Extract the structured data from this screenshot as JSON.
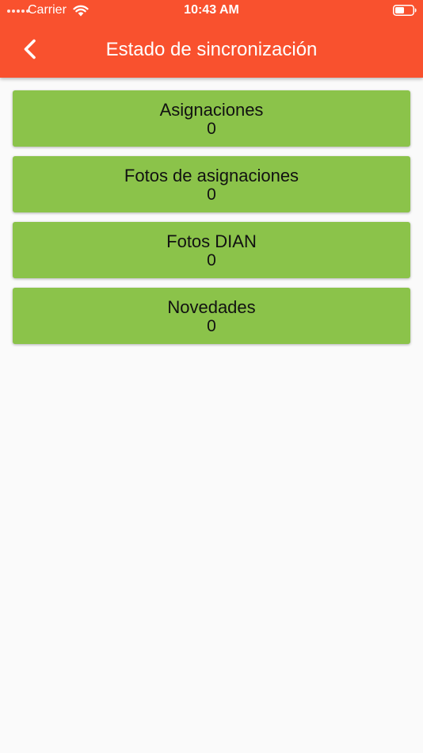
{
  "status_bar": {
    "carrier": "Carrier",
    "time": "10:43 AM"
  },
  "header": {
    "title": "Estado de sincronización",
    "back_icon": "chevron-left-icon"
  },
  "sync_items": [
    {
      "label": "Asignaciones",
      "count": "0"
    },
    {
      "label": "Fotos de asignaciones",
      "count": "0"
    },
    {
      "label": "Fotos DIAN",
      "count": "0"
    },
    {
      "label": "Novedades",
      "count": "0"
    }
  ],
  "colors": {
    "header": "#f9512e",
    "card": "#8bc34a",
    "background": "#fafafa"
  }
}
